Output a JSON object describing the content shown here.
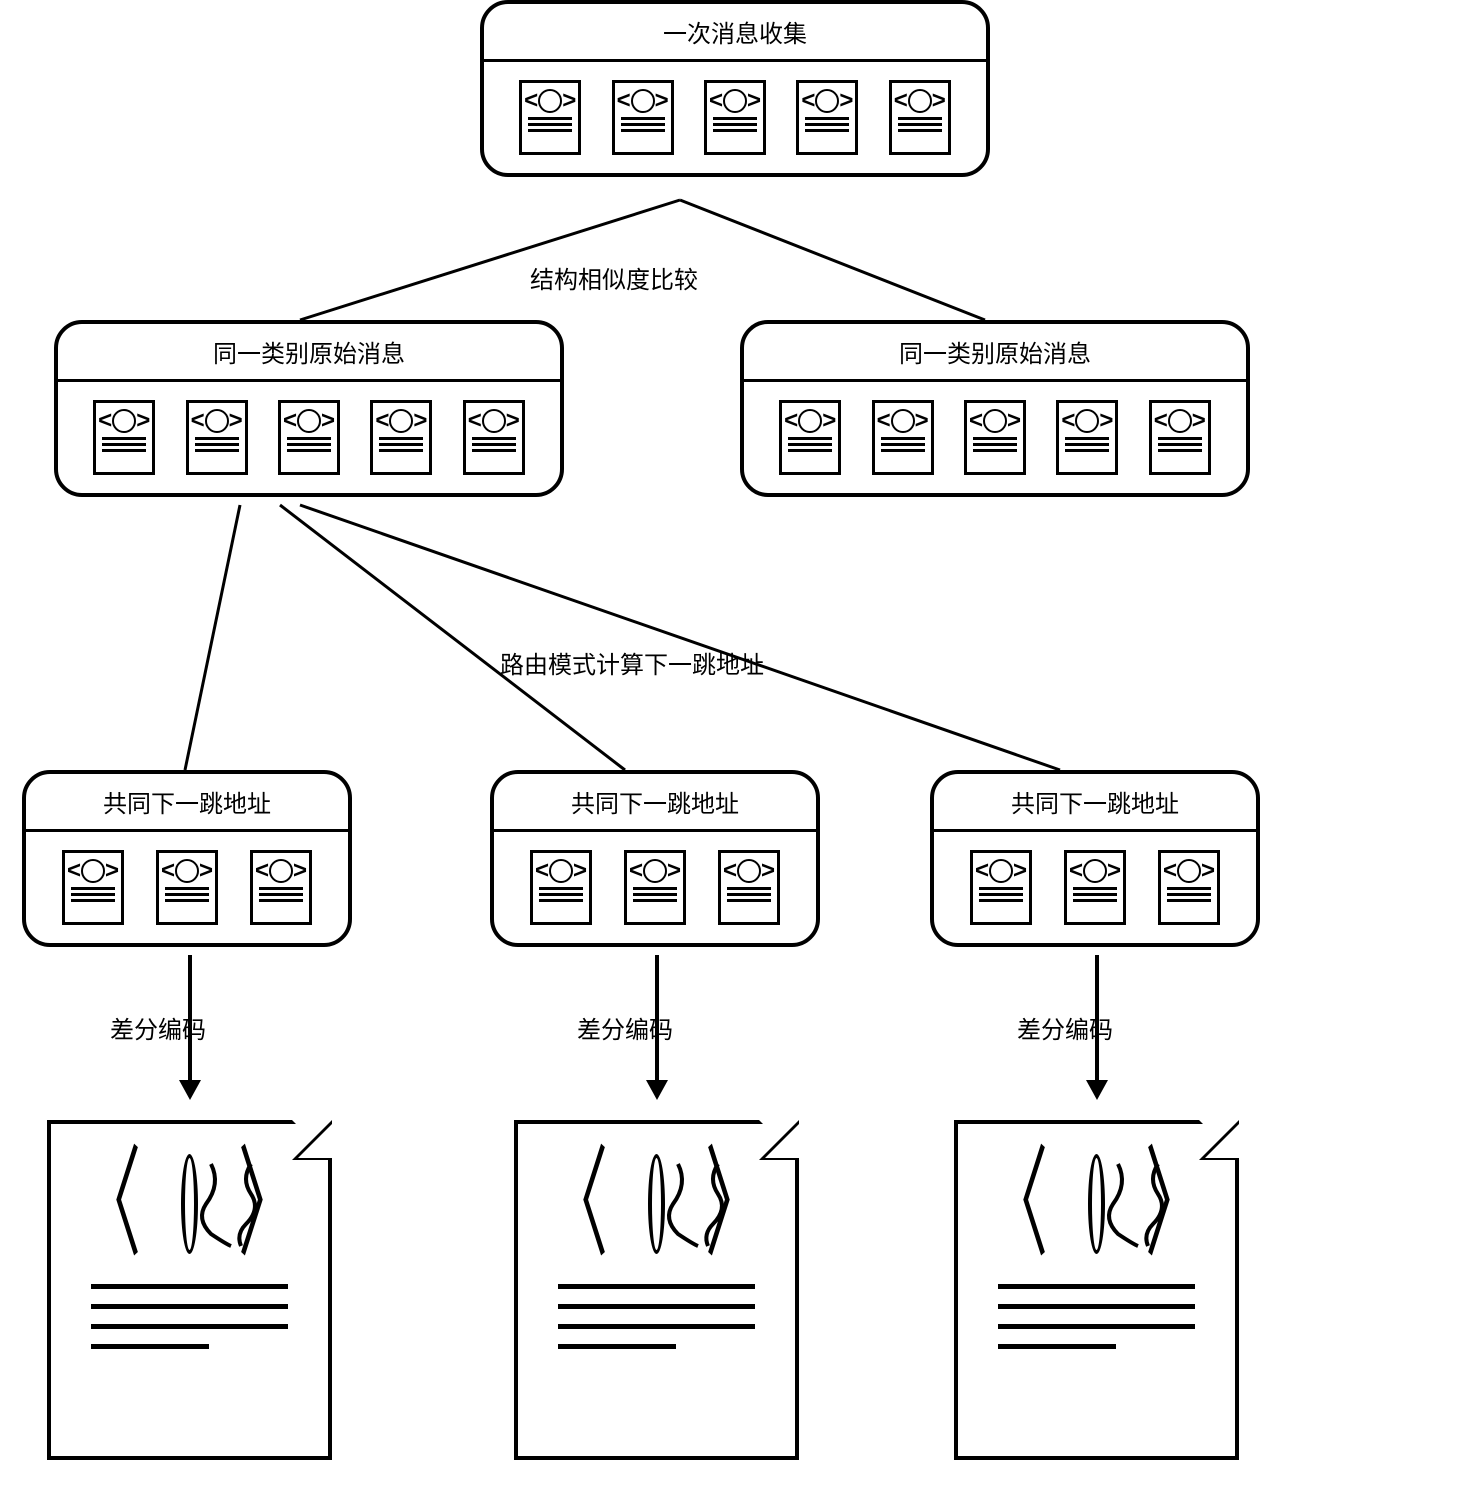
{
  "nodes": {
    "root": {
      "title": "一次消息收集",
      "icons": 5
    },
    "class_left": {
      "title": "同一类别原始消息",
      "icons": 5
    },
    "class_right": {
      "title": "同一类别原始消息",
      "icons": 5
    },
    "hop1": {
      "title": "共同下一跳地址",
      "icons": 3
    },
    "hop2": {
      "title": "共同下一跳地址",
      "icons": 3
    },
    "hop3": {
      "title": "共同下一跳地址",
      "icons": 3
    }
  },
  "edges": {
    "similarity": "结构相似度比较",
    "routing": "路由模式计算下一跳地址",
    "diff1": "差分编码",
    "diff2": "差分编码",
    "diff3": "差分编码"
  }
}
